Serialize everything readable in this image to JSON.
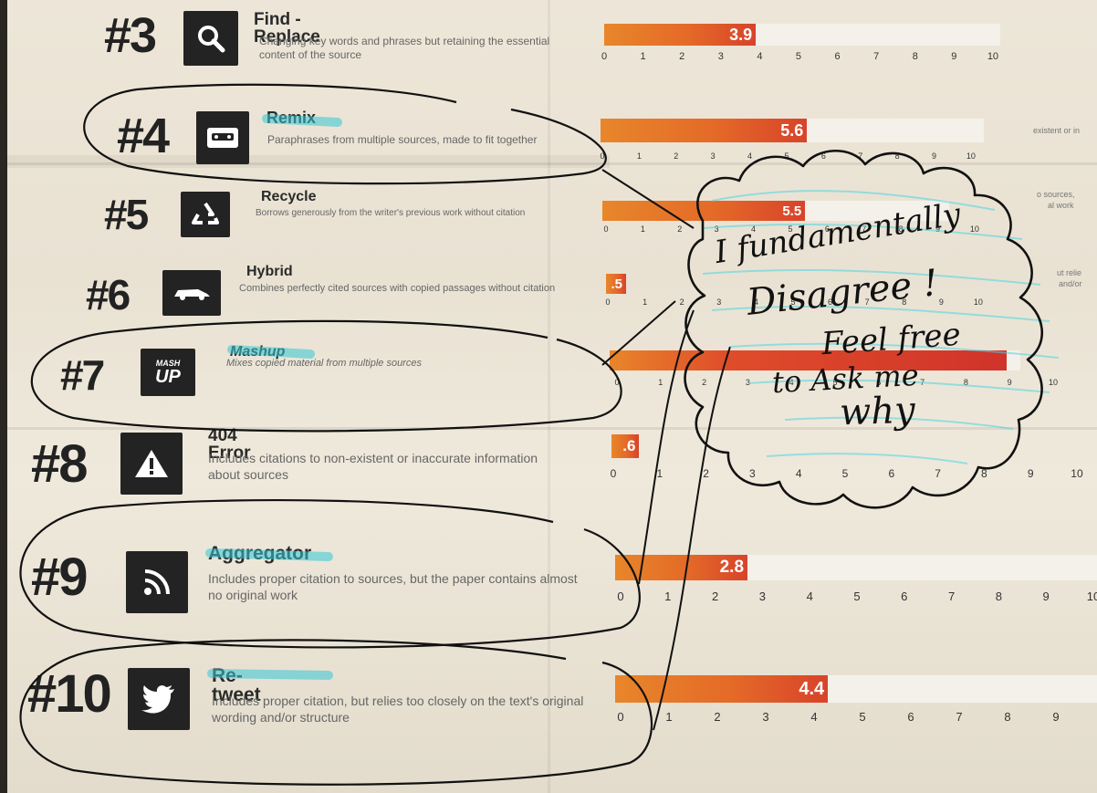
{
  "rows": [
    {
      "number": "#3",
      "title": "Find - Replace",
      "desc": "Changing key words and phrases but retaining the essential content of the source",
      "value_label": "3.9",
      "value": 3.9,
      "icon": "magnifier-icon"
    },
    {
      "number": "#4",
      "title": "Remix",
      "desc": "Paraphrases from multiple sources, made to fit together",
      "value_label": "5.6",
      "value": 5.6,
      "icon": "cassette-icon"
    },
    {
      "number": "#5",
      "title": "Recycle",
      "desc": "Borrows generously from the writer's previous work without citation",
      "value_label": "5.5",
      "value": 5.5,
      "icon": "recycle-icon"
    },
    {
      "number": "#6",
      "title": "Hybrid",
      "desc": "Combines perfectly cited sources with copied passages without citation",
      "value_label": ".5",
      "value": 0.5,
      "icon": "car-icon"
    },
    {
      "number": "#7",
      "title": "Mashup",
      "desc": "Mixes copied material from multiple sources",
      "value_label": "",
      "value": 9.1,
      "icon": "mashup-icon",
      "icon_text_top": "MASH",
      "icon_text_bottom": "UP"
    },
    {
      "number": "#8",
      "title": "404 Error",
      "desc": "Includes citations to non-existent or inaccurate information about sources",
      "value_label": ".6",
      "value": 0.6,
      "icon": "warning-icon"
    },
    {
      "number": "#9",
      "title": "Aggregator",
      "desc": "Includes proper citation to sources, but the paper contains almost no original work",
      "value_label": "2.8",
      "value": 2.8,
      "icon": "rss-icon"
    },
    {
      "number": "#10",
      "title": "Re-tweet",
      "desc": "Includes proper citation, but relies too closely on the text's original wording and/or structure",
      "value_label": "4.4",
      "value": 4.4,
      "icon": "twitter-bird-icon"
    }
  ],
  "axis_ticks": [
    "0",
    "1",
    "2",
    "3",
    "4",
    "5",
    "6",
    "7",
    "8",
    "9",
    "10"
  ],
  "edge_text": {
    "r4": "existent or in",
    "r5a": "o sources,",
    "r5b": "al work",
    "r6a": "ut relie",
    "r6b": "and/or"
  },
  "handwriting": {
    "line1": "I fundamentally",
    "line2": "Disagree !",
    "line3": "Feel free",
    "line4": "to Ask me",
    "line5": "why"
  }
}
